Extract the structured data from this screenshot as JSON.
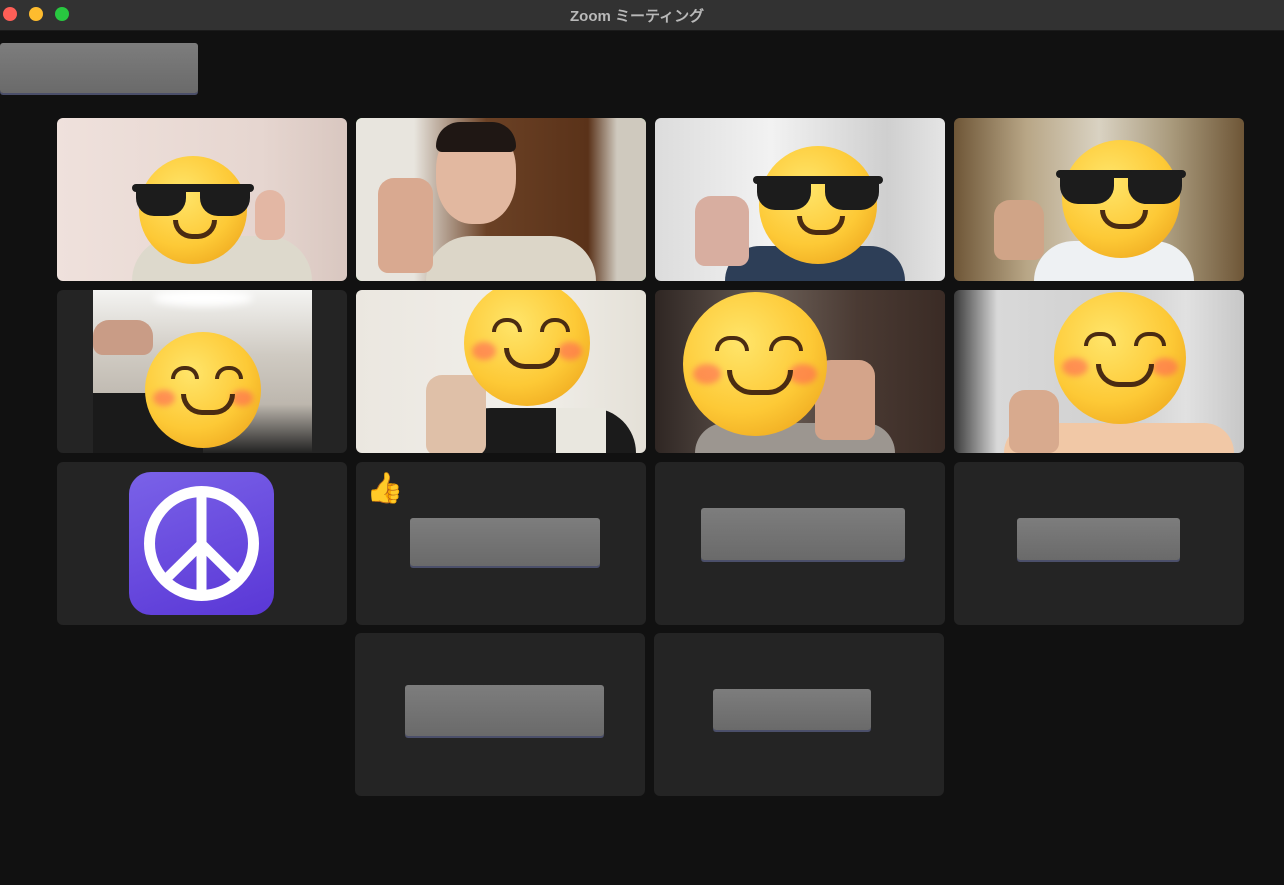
{
  "window": {
    "title": "Zoom ミーティング"
  },
  "colors": {
    "active_speaker_border": "#6ee06e",
    "background": "#111111",
    "tile_bg": "#242424"
  },
  "participants": [
    {
      "video": true,
      "avatar_overlay": "smiling-face-with-sunglasses"
    },
    {
      "video": true,
      "active_speaker": true
    },
    {
      "video": true,
      "avatar_overlay": "smiling-face-with-sunglasses"
    },
    {
      "video": true,
      "avatar_overlay": "smiling-face-with-sunglasses"
    },
    {
      "video": true,
      "avatar_overlay": "smiling-face-with-smiling-eyes"
    },
    {
      "video": true,
      "avatar_overlay": "smiling-face-with-smiling-eyes"
    },
    {
      "video": true,
      "avatar_overlay": "smiling-face-with-smiling-eyes"
    },
    {
      "video": true,
      "avatar_overlay": "smiling-face-with-smiling-eyes"
    },
    {
      "video": false,
      "profile_icon": "peace-symbol-icon"
    },
    {
      "video": false,
      "reaction": "👍",
      "name_redacted": true
    },
    {
      "video": false,
      "name_redacted": true
    },
    {
      "video": false,
      "name_redacted": true
    },
    {
      "video": false,
      "name_redacted": true
    },
    {
      "video": false,
      "name_redacted": true
    }
  ],
  "reactions": {
    "thumbs_up": "👍"
  }
}
